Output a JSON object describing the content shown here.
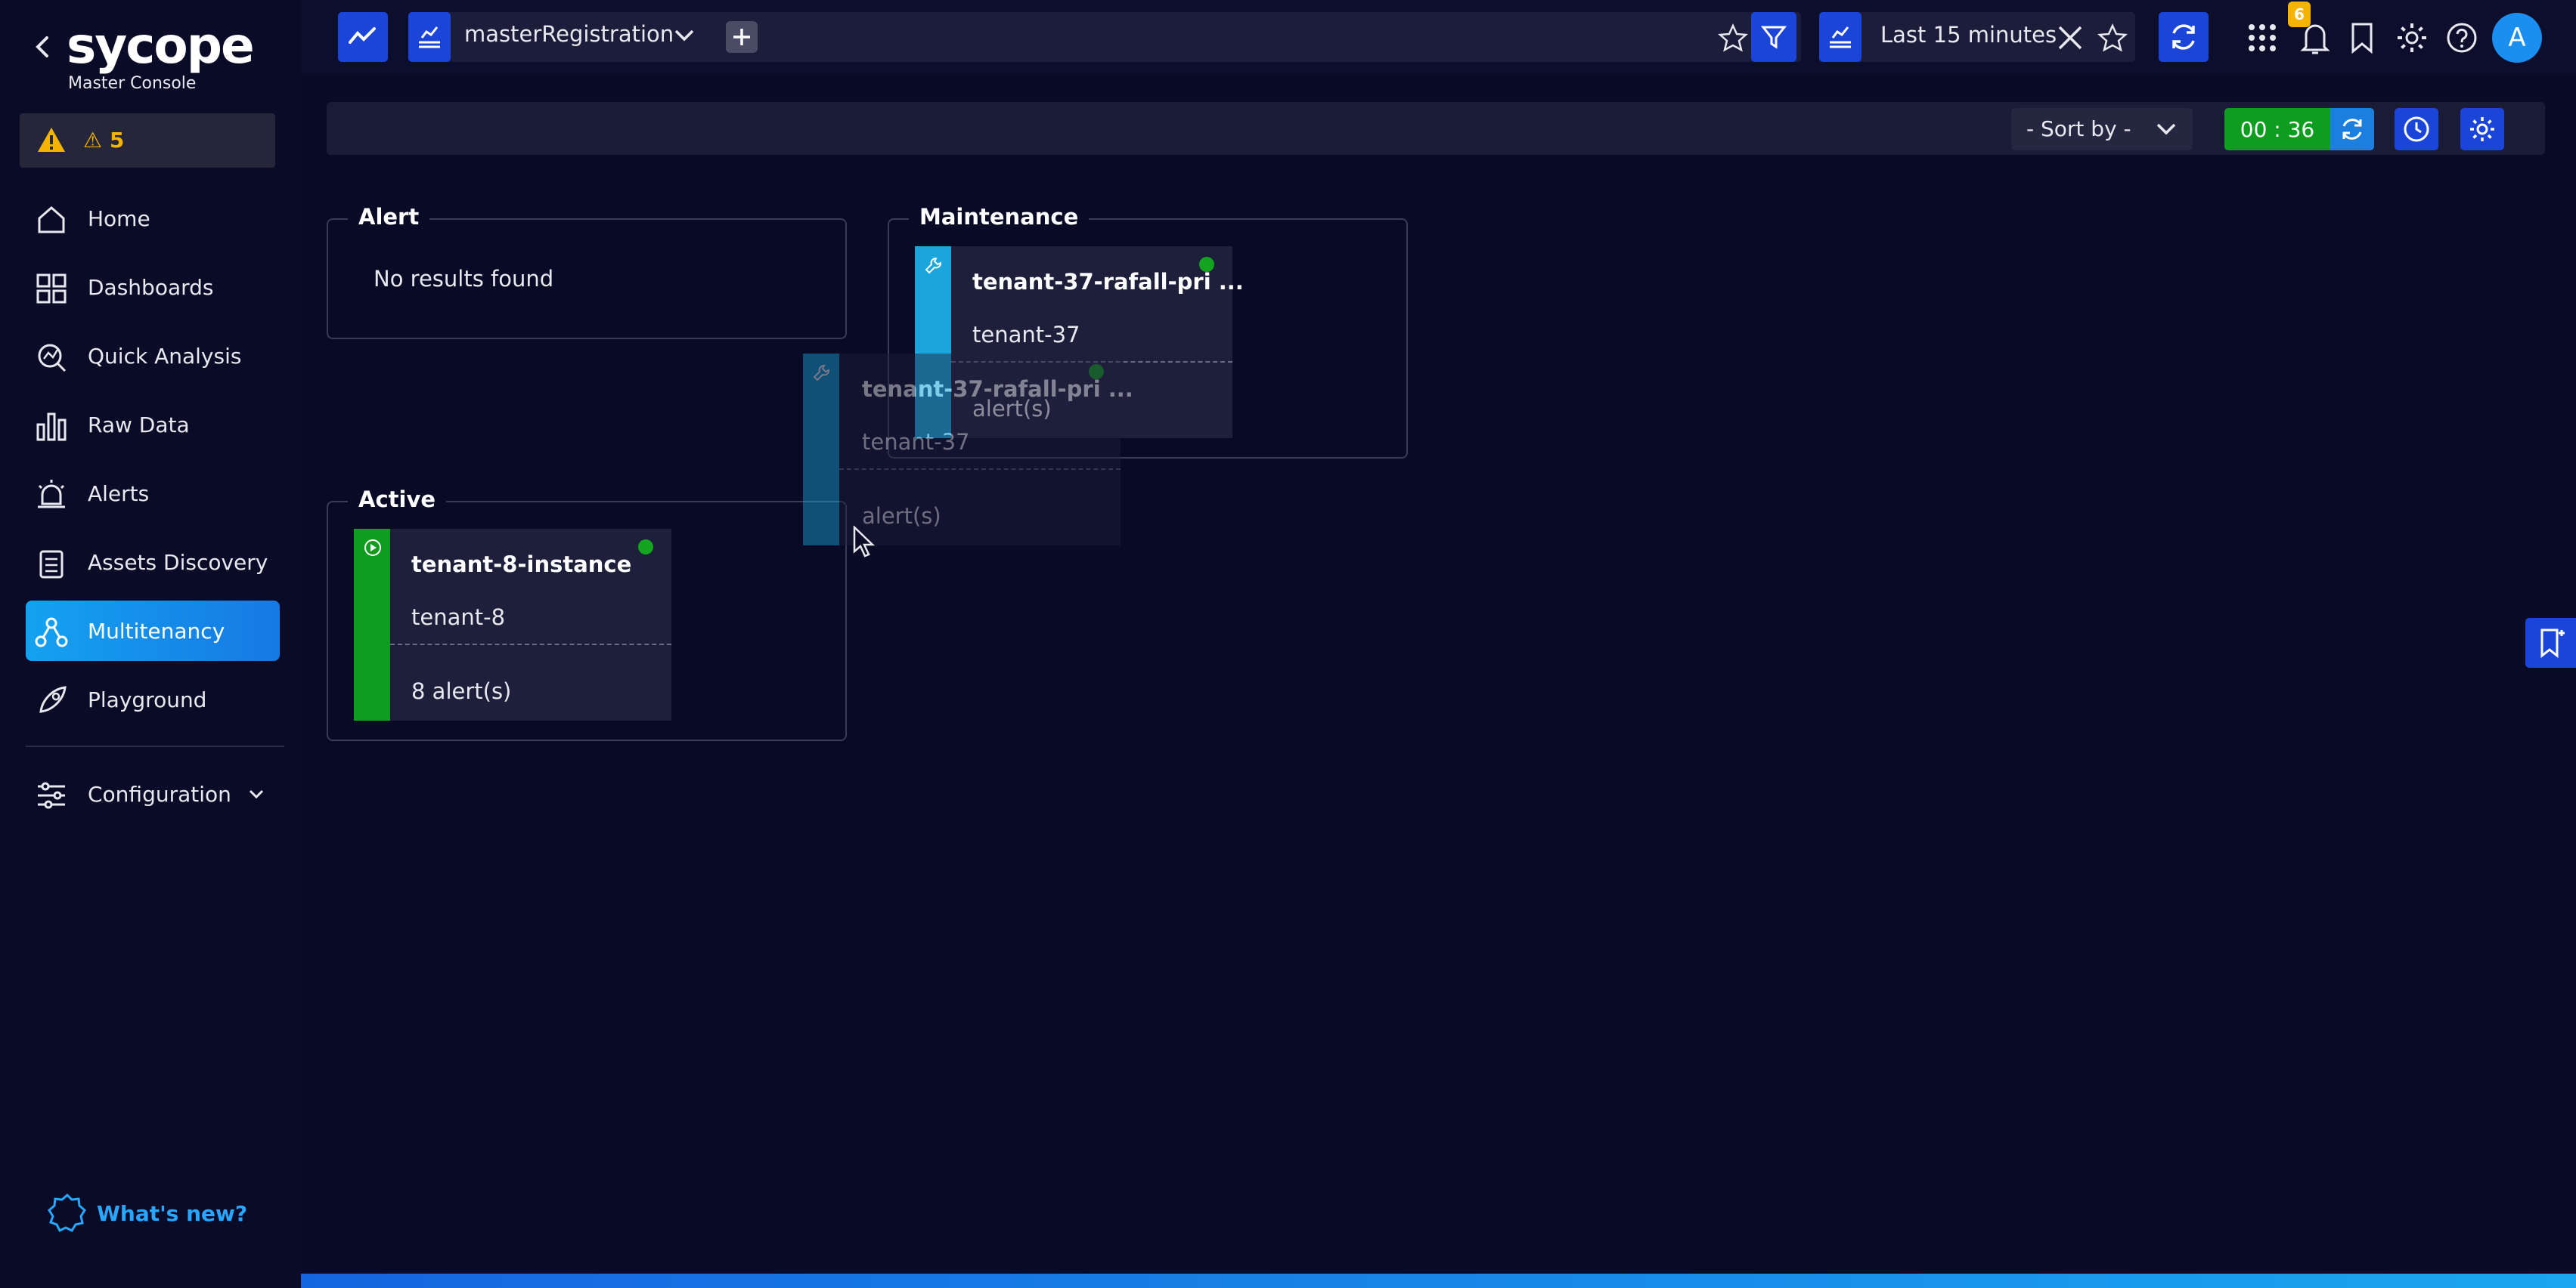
{
  "sidebar": {
    "logo": "sycope",
    "subtitle": "Master Console",
    "alert_count": "5",
    "items": [
      {
        "label": "Home",
        "icon": "home-icon"
      },
      {
        "label": "Dashboards",
        "icon": "dashboards-icon"
      },
      {
        "label": "Quick Analysis",
        "icon": "quick-analysis-icon"
      },
      {
        "label": "Raw Data",
        "icon": "raw-data-icon"
      },
      {
        "label": "Alerts",
        "icon": "alerts-icon"
      },
      {
        "label": "Assets Discovery",
        "icon": "assets-discovery-icon"
      },
      {
        "label": "Multitenancy",
        "icon": "multitenancy-icon",
        "active": true
      },
      {
        "label": "Playground",
        "icon": "playground-icon"
      },
      {
        "label": "Configuration",
        "icon": "configuration-icon"
      }
    ],
    "whats_new": "What's new?"
  },
  "topbar": {
    "query_name": "masterRegistration",
    "time_range": "Last 15 minutes",
    "notification_count": "6",
    "user_initial": "A"
  },
  "toolbar": {
    "sort_label": "- Sort by -",
    "timer": "00 : 36"
  },
  "groups": {
    "alert": {
      "title": "Alert",
      "empty_text": "No results found"
    },
    "maintenance": {
      "title": "Maintenance",
      "card": {
        "title": "tenant-37-rafall-pri ...",
        "tenant": "tenant-37",
        "alerts": "alert(s)"
      }
    },
    "active": {
      "title": "Active",
      "card": {
        "title": "tenant-8-instance",
        "tenant": "tenant-8",
        "alerts": "8 alert(s)"
      }
    }
  },
  "dragged_card": {
    "title": "tenant-37-rafall-pri ...",
    "tenant": "tenant-37",
    "alerts": "alert(s)"
  },
  "colors": {
    "background": "#090a25",
    "accent_blue": "#1b44d8",
    "active_green": "#0f9d1f",
    "maintenance_cyan": "#1aa6dc",
    "warning": "#f5b400"
  }
}
